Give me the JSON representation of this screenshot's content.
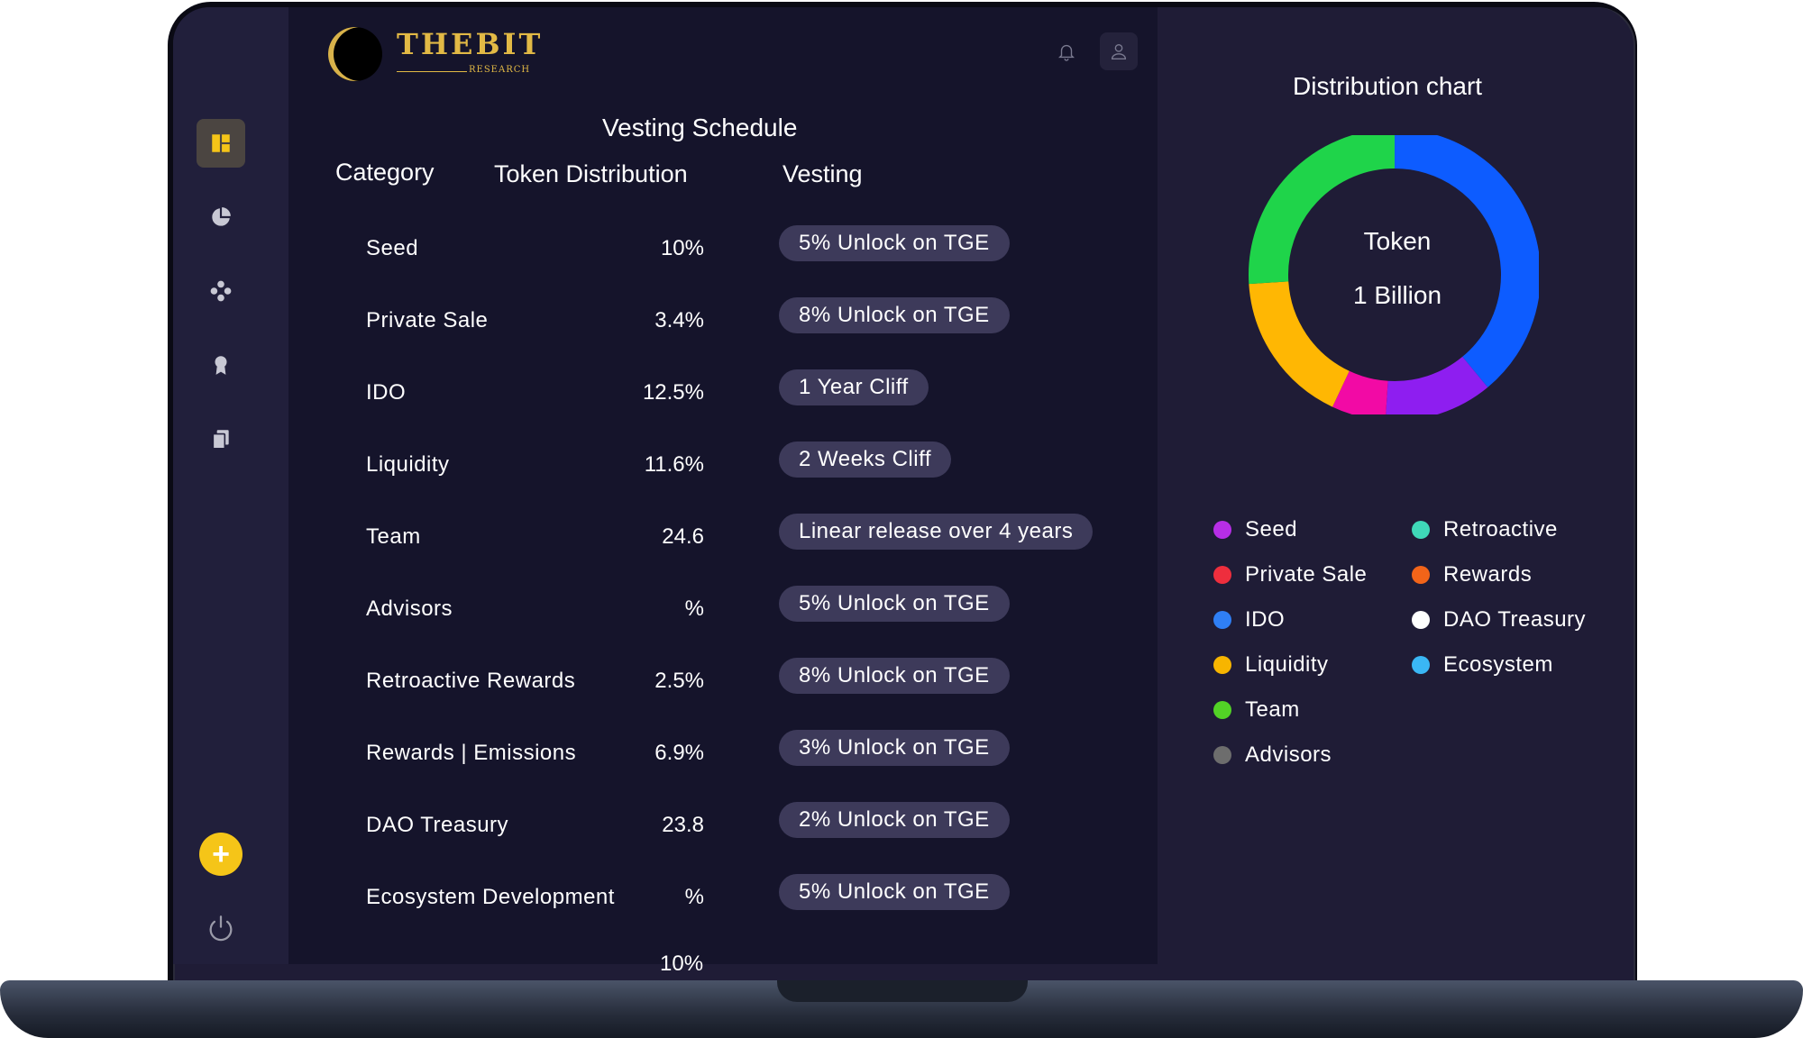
{
  "brand": {
    "name": "THEBIT",
    "sub": "RESEARCH"
  },
  "nav_icons": [
    "dashboard-icon",
    "pie-chart-icon",
    "tokens-icon",
    "award-icon",
    "documents-icon"
  ],
  "fab_label": "+",
  "vesting": {
    "title": "Vesting Schedule",
    "columns": {
      "category": "Category",
      "distribution": "Token Distribution",
      "vesting": "Vesting"
    },
    "rows": [
      {
        "category": "Seed",
        "pct": "10%",
        "vesting": "5% Unlock on TGE"
      },
      {
        "category": "Private Sale",
        "pct": "3.4%",
        "vesting": "8% Unlock on TGE"
      },
      {
        "category": "IDO",
        "pct": "12.5%",
        "vesting": "1 Year Cliff"
      },
      {
        "category": "Liquidity",
        "pct": "11.6%",
        "vesting": "2 Weeks Cliff"
      },
      {
        "category": "Team",
        "pct": "24.6",
        "vesting": "Linear release over 4 years"
      },
      {
        "category": "Advisors",
        "pct": "%",
        "vesting": "5% Unlock on TGE"
      },
      {
        "category": "Retroactive Rewards",
        "pct": "2.5%",
        "vesting": "8% Unlock on TGE"
      },
      {
        "category": "Rewards | Emissions",
        "pct": "6.9%",
        "vesting": "3% Unlock on TGE"
      },
      {
        "category": "DAO Treasury",
        "pct": "23.8",
        "vesting": "2% Unlock on TGE"
      },
      {
        "category": "Ecosystem Development",
        "pct": "%",
        "vesting": "5% Unlock on TGE"
      }
    ],
    "cut_off_value": "10%"
  },
  "distribution": {
    "title": "Distribution chart",
    "center_label": "Token",
    "center_value": "1 Billion",
    "legend": [
      {
        "label": "Seed",
        "color": "#b72ee6"
      },
      {
        "label": "Private Sale",
        "color": "#ee2e3d"
      },
      {
        "label": "IDO",
        "color": "#2f7ff5"
      },
      {
        "label": "Liquidity",
        "color": "#f7b500"
      },
      {
        "label": "Team",
        "color": "#52d226"
      },
      {
        "label": "Advisors",
        "color": "#6d6d6d"
      },
      {
        "label": "Retroactive",
        "color": "#3fd8b8"
      },
      {
        "label": "Rewards",
        "color": "#f26419"
      },
      {
        "label": "DAO Treasury",
        "color": "#ffffff"
      },
      {
        "label": "Ecosystem",
        "color": "#3ab7f5"
      }
    ]
  },
  "chart_data": {
    "type": "pie",
    "title": "Distribution chart",
    "categories": [
      "IDO",
      "Seed",
      "Private Sale",
      "Liquidity",
      "Team"
    ],
    "values": [
      39,
      12,
      6,
      17,
      26
    ],
    "colors": [
      "#0d5cff",
      "#8e1ef0",
      "#f20aa5",
      "#ffb703",
      "#1fd44a"
    ]
  }
}
